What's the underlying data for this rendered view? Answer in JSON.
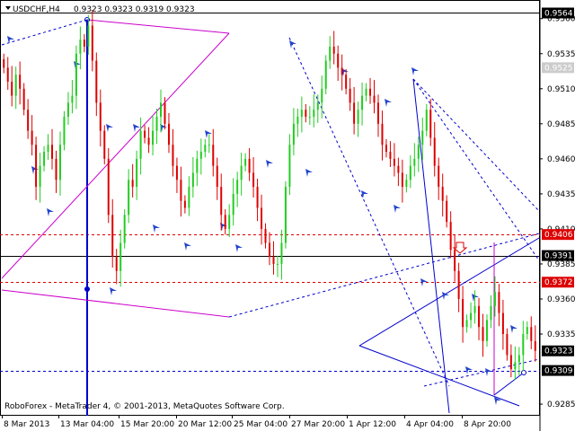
{
  "window": {
    "symbol": "USDCHF,H4",
    "ohlc": "0.9323 0.9323 0.9319 0.9323",
    "copyright": "RoboForex - MetaTrader 4, © 2001-2013, MetaQuotes Software Corp."
  },
  "colors": {
    "bull": "#22cc22",
    "bear": "#dd0000",
    "wave_lines": "#0000cc",
    "magenta": "#cc00cc",
    "red_level": "#dd0000",
    "grid": "#000000",
    "price_label_bg": "#000000",
    "price_label_red_bg": "#dd0000",
    "light_label_bg": "#cccccc"
  },
  "chart_data": {
    "type": "candlestick",
    "title": "USDCHF,H4",
    "ylim": [
      0.9278,
      0.9572
    ],
    "y_ticks": [
      "0.9560",
      "0.9535",
      "0.9510",
      "0.9485",
      "0.9460",
      "0.9435",
      "0.9410",
      "0.9385",
      "0.9360",
      "0.9335",
      "0.9285"
    ],
    "x_ticks": [
      "8 Mar 2013",
      "13 Mar 04:00",
      "15 Mar 20:00",
      "20 Mar 12:00",
      "25 Mar 04:00",
      "27 Mar 20:00",
      "1 Apr 12:00",
      "4 Apr 04:00",
      "8 Apr 20:00"
    ],
    "price_labels": [
      {
        "value": "0.9564",
        "style": "black"
      },
      {
        "value": "0.9525",
        "style": "light"
      },
      {
        "value": "0.9406",
        "style": "red"
      },
      {
        "value": "0.9391",
        "style": "black"
      },
      {
        "value": "0.9372",
        "style": "red"
      },
      {
        "value": "0.9323",
        "style": "black"
      },
      {
        "value": "0.9309",
        "style": "black"
      }
    ],
    "horizontal_levels": [
      {
        "value": 0.9564,
        "style": "solid-black"
      },
      {
        "value": 0.9406,
        "style": "dashed-red"
      },
      {
        "value": 0.9391,
        "style": "solid-black"
      },
      {
        "value": 0.9372,
        "style": "dashed-red"
      },
      {
        "value": 0.9309,
        "style": "dashed-blue"
      }
    ],
    "close_series": [
      0.9525,
      0.9515,
      0.9505,
      0.952,
      0.951,
      0.9495,
      0.948,
      0.947,
      0.944,
      0.9455,
      0.9465,
      0.947,
      0.946,
      0.9445,
      0.947,
      0.949,
      0.95,
      0.9505,
      0.9535,
      0.9545,
      0.954,
      0.9555,
      0.953,
      0.95,
      0.948,
      0.946,
      0.942,
      0.939,
      0.938,
      0.94,
      0.942,
      0.9445,
      0.944,
      0.946,
      0.948,
      0.9475,
      0.947,
      0.948,
      0.949,
      0.95,
      0.9485,
      0.947,
      0.9455,
      0.9445,
      0.943,
      0.9425,
      0.944,
      0.945,
      0.946,
      0.9465,
      0.947,
      0.947,
      0.9455,
      0.944,
      0.942,
      0.941,
      0.942,
      0.9435,
      0.9445,
      0.9455,
      0.946,
      0.945,
      0.944,
      0.9425,
      0.941,
      0.94,
      0.939,
      0.9385,
      0.9385,
      0.94,
      0.944,
      0.947,
      0.9485,
      0.949,
      0.9495,
      0.949,
      0.949,
      0.9495,
      0.95,
      0.951,
      0.953,
      0.954,
      0.9535,
      0.9525,
      0.952,
      0.951,
      0.95,
      0.9485,
      0.9495,
      0.9505,
      0.951,
      0.9505,
      0.95,
      0.9485,
      0.947,
      0.9465,
      0.946,
      0.9455,
      0.945,
      0.944,
      0.9445,
      0.9455,
      0.946,
      0.947,
      0.948,
      0.9495,
      0.9475,
      0.9455,
      0.944,
      0.943,
      0.9415,
      0.9395,
      0.938,
      0.936,
      0.934,
      0.9345,
      0.935,
      0.9355,
      0.934,
      0.933,
      0.9345,
      0.9355,
      0.9365,
      0.935,
      0.9335,
      0.932,
      0.931,
      0.9315,
      0.932,
      0.9335,
      0.934,
      0.933,
      0.9323
    ]
  }
}
